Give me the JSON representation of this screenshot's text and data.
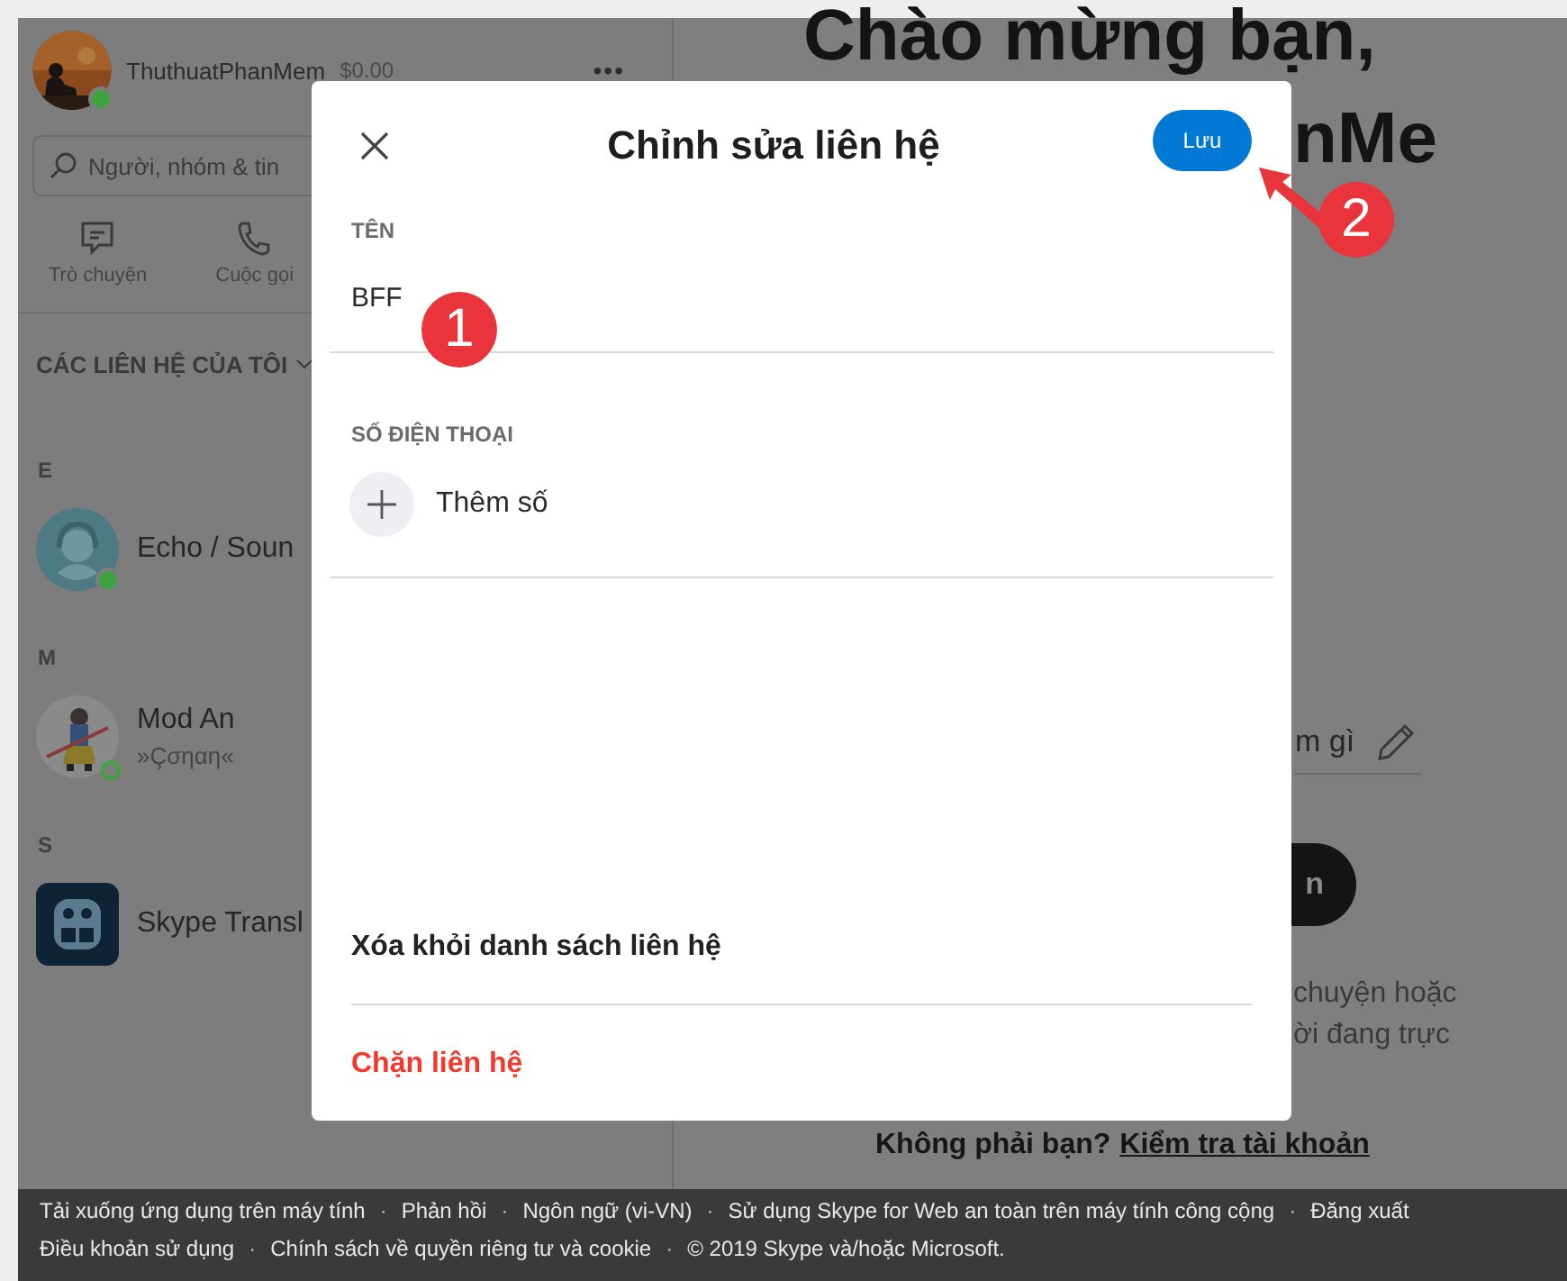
{
  "sidebar": {
    "profile": {
      "name": "ThuthuatPhanMem",
      "balance": "$0.00",
      "online": true,
      "more": "•••"
    },
    "search": {
      "placeholder": "Người, nhóm & tin"
    },
    "nav_tabs": [
      {
        "label": "Trò chuyện"
      },
      {
        "label": "Cuộc gọi"
      }
    ],
    "contacts_header": "CÁC LIÊN HỆ CỦA TÔI",
    "groups": [
      {
        "letter": "E",
        "contacts": [
          {
            "name": "Echo / Soun",
            "kind": "headset",
            "online": true,
            "idle": false
          }
        ]
      },
      {
        "letter": "M",
        "contacts": [
          {
            "name": "Mod An",
            "status": "»Çσηαη«",
            "kind": "picture",
            "online": false,
            "idle": true
          }
        ]
      },
      {
        "letter": "S",
        "contacts": [
          {
            "name": "Skype Transl",
            "kind": "robot",
            "online": false,
            "idle": false
          }
        ]
      }
    ]
  },
  "main": {
    "heading_lines": [
      "Chào mừng bạn,",
      "nMe"
    ],
    "mood_field": {
      "placeholder": "m gì"
    },
    "dark_button": {
      "label": "n"
    },
    "info_lines": [
      "chuyện hoặc",
      "ời đang trực"
    ],
    "account_prompt": {
      "text": "Không phải bạn?",
      "link": "Kiểm tra tài khoản"
    }
  },
  "dialog": {
    "title": "Chỉnh sửa liên hệ",
    "save_button": "Lưu",
    "name_label": "TÊN",
    "name_value": "BFF",
    "phone_label": "SỐ ĐIỆN THOẠI",
    "add_phone": "Thêm số",
    "actions": [
      {
        "label": "Xóa khỏi danh sách liên hệ",
        "kind": "normal"
      },
      {
        "label": "Chặn liên hệ",
        "kind": "danger"
      }
    ]
  },
  "annotations": [
    {
      "label": "1",
      "kind": "circle"
    },
    {
      "label": "2",
      "kind": "arrow"
    }
  ],
  "footer": {
    "separator": "·",
    "lines": [
      [
        "Tải xuống ứng dụng trên máy tính",
        "Phản hồi",
        "Ngôn ngữ (vi-VN)",
        "Sử dụng Skype for Web an toàn trên máy tính công cộng",
        "Đăng xuất"
      ],
      [
        "Điều khoản sử dụng",
        "Chính sách về quyền riêng tư và cookie",
        "© 2019 Skype và/hoặc Microsoft."
      ]
    ]
  }
}
